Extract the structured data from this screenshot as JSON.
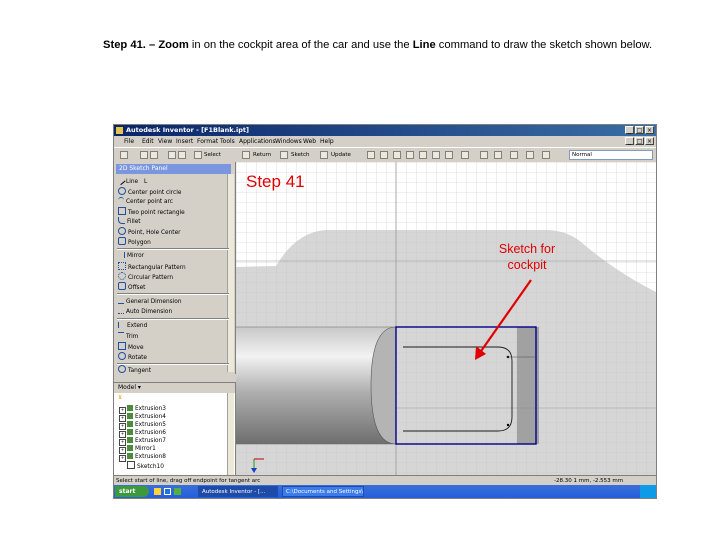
{
  "caption": {
    "prefix": "Step 41. – ",
    "zoom_word": "Zoom",
    "middle": " in on the cockpit area of the car and use the ",
    "line_word": "Line",
    "suffix": " command to draw the sketch shown below."
  },
  "window": {
    "title": "Autodesk Inventor - [F1Blank.ipt]"
  },
  "menu": [
    "File",
    "Edit",
    "View",
    "Insert",
    "Format",
    "Tools",
    "Applications",
    "Windows",
    "Web",
    "Help"
  ],
  "toolbar": {
    "select_label": "Select",
    "return_label": "Return",
    "sketch_label": "Sketch",
    "update_label": "Update",
    "material_value": "Normal"
  },
  "sketch_panel": {
    "title": "2D Sketch Panel",
    "tools": [
      "Line",
      "Center point circle",
      "Center point arc",
      "Two point rectangle",
      "Fillet",
      "Point, Hole Center",
      "Polygon",
      "Mirror",
      "Rectangular Pattern",
      "Circular Pattern",
      "Offset",
      "General Dimension",
      "Auto Dimension",
      "Extend",
      "Trim",
      "Move",
      "Rotate",
      "Tangent"
    ],
    "line_shortcut": "L"
  },
  "model_browser": {
    "title": "Model",
    "items": [
      "Extrusion3",
      "Extrusion4",
      "Extrusion5",
      "Extrusion6",
      "Extrusion7",
      "Mirror1",
      "Extrusion8",
      "Sketch10"
    ]
  },
  "annotations": {
    "step_label": "Step 41",
    "sketch_label_line1": "Sketch for",
    "sketch_label_line2": "cockpit",
    "accent_red": "#e00000",
    "sketch_blue": "#00008b"
  },
  "status": {
    "hint": "Select start of line, drag off endpoint for tangent arc",
    "coords": "-28.30 1 mm, -2.553 mm"
  },
  "taskbar": {
    "start_label": "start",
    "tasks": [
      "Autodesk Inventor - [...",
      "C:\\Documents and Settings\\..."
    ]
  }
}
